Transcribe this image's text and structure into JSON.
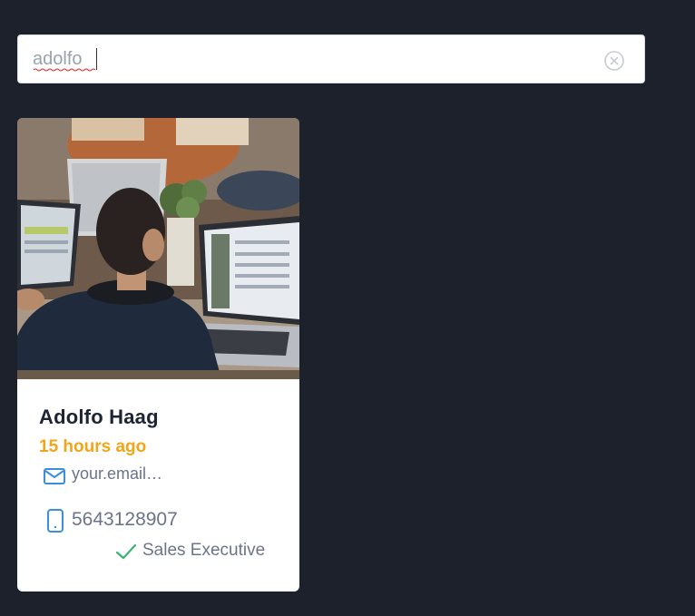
{
  "search": {
    "value": "adolfo",
    "icon": "close-circle-icon"
  },
  "results": [
    {
      "name": "Adolfo Haag",
      "time_ago": "15 hours ago",
      "email": "your.email…",
      "phone": "5643128907",
      "role": "Sales Executive",
      "photo_alt": "Man working on laptop in office",
      "icons": {
        "email": "envelope-icon",
        "phone": "mobile-phone-icon",
        "role": "checkmark-icon"
      }
    }
  ],
  "colors": {
    "background": "#1c212b",
    "time_accent": "#f2a516",
    "icon_blue": "#3b8fd8",
    "check_green": "#3cb371",
    "muted_text": "#6b7488"
  }
}
